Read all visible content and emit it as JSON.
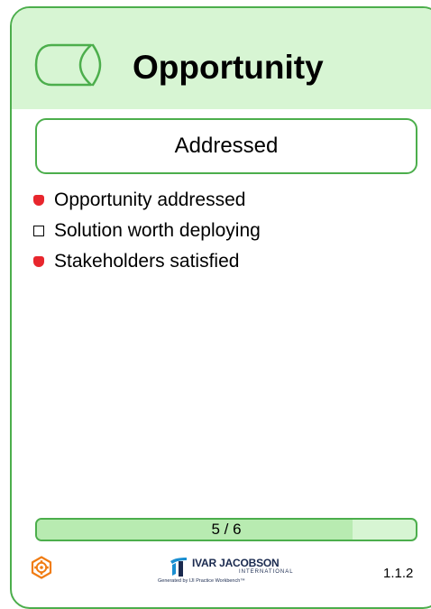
{
  "card": {
    "title": "Opportunity",
    "state": "Addressed",
    "checklist": [
      {
        "label": "Opportunity addressed",
        "checked": true
      },
      {
        "label": "Solution worth deploying",
        "checked": false
      },
      {
        "label": "Stakeholders satisfied",
        "checked": true
      }
    ],
    "progress": {
      "text": "5 / 6",
      "current": 5,
      "total": 6
    },
    "logo": {
      "name": "IVAR JACOBSON",
      "sub": "INTERNATIONAL",
      "generated": "Generated by IJI Practice Workbench™"
    },
    "version": "1.1.2"
  },
  "icons": {
    "alpha": "alpha-card-icon",
    "practice": "hexagon-gear-icon",
    "logo_mark": "ivar-jacobson-logo-mark"
  },
  "colors": {
    "border": "#4cae4c",
    "header_background": "#d7f5d3",
    "checked_bullet": "#e8262d",
    "gear_icon": "#f07c13",
    "logo_blue": "#1a8fd1"
  }
}
